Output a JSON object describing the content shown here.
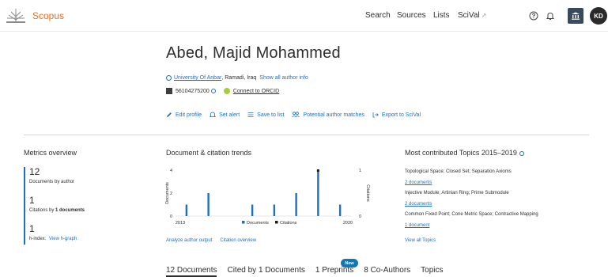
{
  "header": {
    "logo_text": "Scopus",
    "nav": {
      "search": "Search",
      "sources": "Sources",
      "lists": "Lists",
      "scival": "SciVal",
      "scival_ext": "↗"
    },
    "avatar_initials": "KD"
  },
  "profile": {
    "name": "Abed, Majid Mohammed",
    "affiliation": "University Of Anbar",
    "location": ", Ramadi, Iraq",
    "show_all_info": "Show all author info",
    "author_id": "56104275200",
    "connect_orcid": "Connect to ORCID",
    "actions": {
      "edit_profile": "Edit profile",
      "set_alert": "Set alert",
      "save_to_list": "Save to list",
      "potential_matches": "Potential author matches",
      "export_scival": "Export to SciVal"
    }
  },
  "metrics": {
    "title": "Metrics overview",
    "documents_value": "12",
    "documents_label": "Documents by author",
    "citations_value": "1",
    "citations_label_prefix": "Citations by ",
    "citations_label_bold": "1 documents",
    "h_index_value": "1",
    "h_index_label": "h-index:",
    "view_h_graph": "View h-graph"
  },
  "trends": {
    "title": "Document & citation trends",
    "analyze_output": "Analyze author output",
    "citation_overview": "Citation overview"
  },
  "chart_data": {
    "type": "bar",
    "title": "Document & citation trends",
    "x_start_label": "2013",
    "x_end_label": "2020",
    "ylabel_left": "Documents",
    "ylabel_right": "Citations",
    "left_ticks": [
      "4",
      "2",
      "0"
    ],
    "right_ticks": [
      "1",
      "0"
    ],
    "ylim_left": [
      0,
      4
    ],
    "ylim_right": [
      0,
      1
    ],
    "series": [
      {
        "name": "Documents",
        "color": "#1f6fbf",
        "points": [
          {
            "x": 0.5,
            "y": 1
          },
          {
            "x": 1.5,
            "y": 2
          },
          {
            "x": 3.5,
            "y": 1
          },
          {
            "x": 4.5,
            "y": 1
          },
          {
            "x": 5.5,
            "y": 2
          },
          {
            "x": 6.5,
            "y": 4
          },
          {
            "x": 7.5,
            "y": 1
          }
        ]
      },
      {
        "name": "Citations",
        "color": "#1a1a1a",
        "points": [
          {
            "x": 6.5,
            "y": 1
          }
        ]
      }
    ],
    "x_range": [
      0,
      8
    ],
    "legend": [
      "Documents",
      "Citations"
    ],
    "legend_position": "bottom"
  },
  "topics": {
    "title": "Most contributed Topics 2015–2019",
    "items": [
      {
        "name": "Topological Space; Closed Set; Separation Axioms",
        "count": "2 documents"
      },
      {
        "name": "Injective Module; Artinian Ring; Prime Submodule",
        "count": "2 documents"
      },
      {
        "name": "Common Fixed Point; Cone Metric Space; Contractive Mapping",
        "count": "1 document"
      }
    ],
    "view_all": "View all Topics"
  },
  "tabs": {
    "documents": "12 Documents",
    "cited_by": "Cited by 1 Documents",
    "preprints": "1 Preprints",
    "new_badge": "New",
    "co_authors": "8 Co-Authors",
    "topics": "Topics"
  }
}
